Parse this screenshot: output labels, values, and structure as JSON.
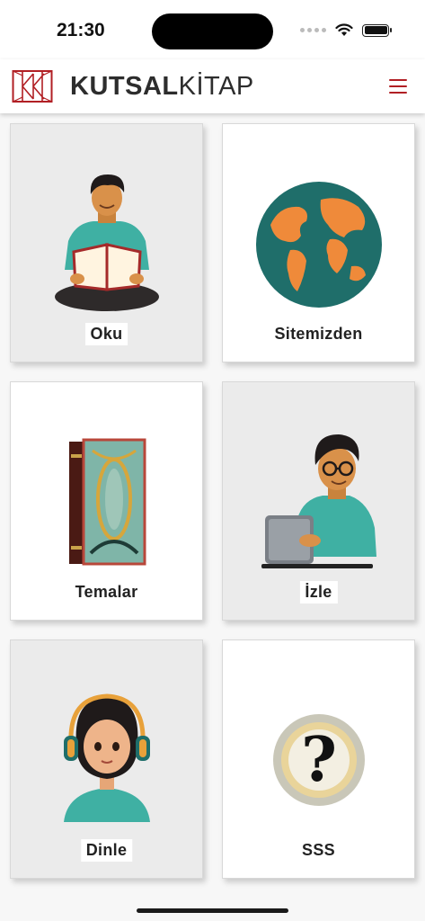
{
  "status_bar": {
    "time": "21:30",
    "icons": [
      "cellular-icon",
      "wifi-icon",
      "battery-icon"
    ]
  },
  "header": {
    "brand_bold": "KUTSAL",
    "brand_light": "KİTAP",
    "brand_color": "#b11f24",
    "menu_icon": "hamburger-menu-icon"
  },
  "tiles": [
    {
      "label": "Oku",
      "icon": "reading-person-icon"
    },
    {
      "label": "Sitemizden",
      "icon": "globe-icon"
    },
    {
      "label": "Temalar",
      "icon": "book-icon"
    },
    {
      "label": "İzle",
      "icon": "tablet-viewer-icon"
    },
    {
      "label": "Dinle",
      "icon": "headphones-girl-icon"
    },
    {
      "label": "SSS",
      "icon": "question-mark-icon"
    }
  ]
}
